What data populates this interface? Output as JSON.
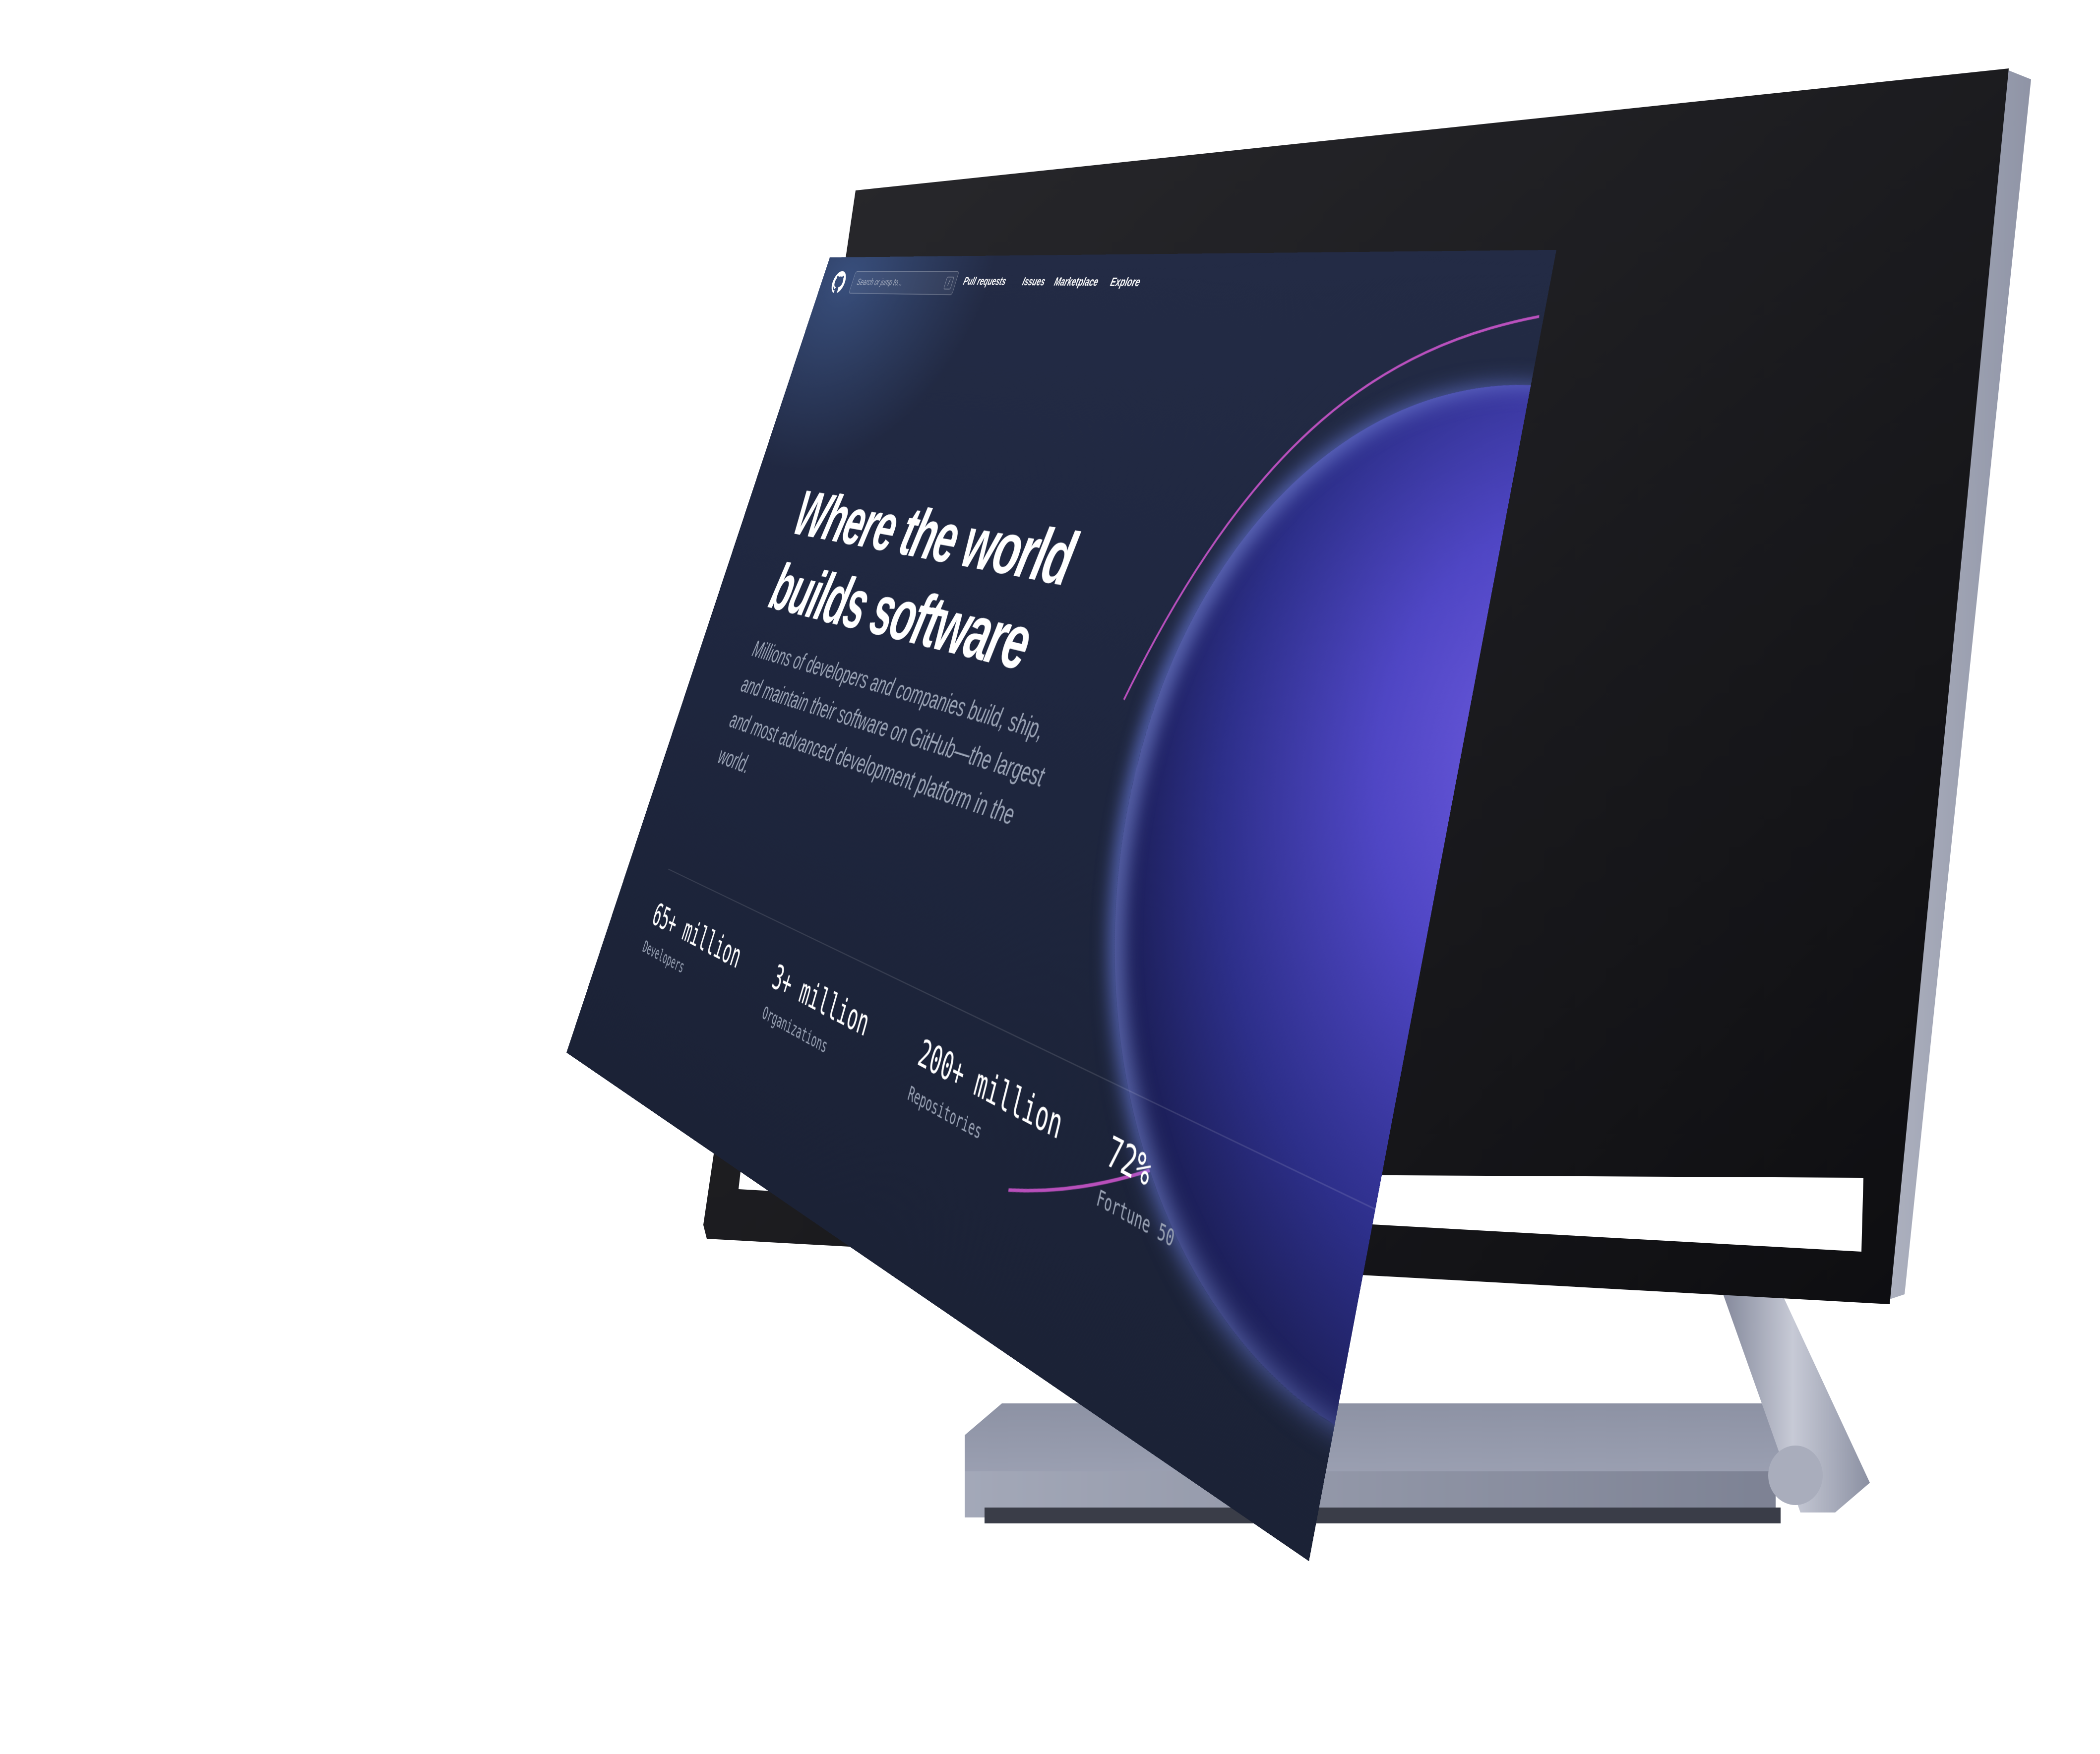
{
  "search": {
    "placeholder": "Search or jump to...",
    "shortcut": "/"
  },
  "nav": {
    "links": [
      {
        "label": "Pull requests"
      },
      {
        "label": "Issues"
      },
      {
        "label": "Marketplace"
      },
      {
        "label": "Explore"
      }
    ]
  },
  "hero": {
    "title_line1": "Where the world",
    "title_line2": "builds software",
    "subtitle": "Millions of developers and companies build, ship, and maintain their software on GitHub—the largest and most advanced development platform in the world."
  },
  "stats": [
    {
      "value": "65+ million",
      "label": "Developers"
    },
    {
      "value": "3+ million",
      "label": "Organizations"
    },
    {
      "value": "200+ million",
      "label": "Repositories"
    },
    {
      "value": "72%",
      "label": "Fortune 50"
    }
  ],
  "icons": {
    "logo": "github-logo-icon"
  },
  "colors": {
    "accent": "#5b4fd8",
    "background": "#1f2740",
    "text_muted": "#9aa3b5"
  }
}
